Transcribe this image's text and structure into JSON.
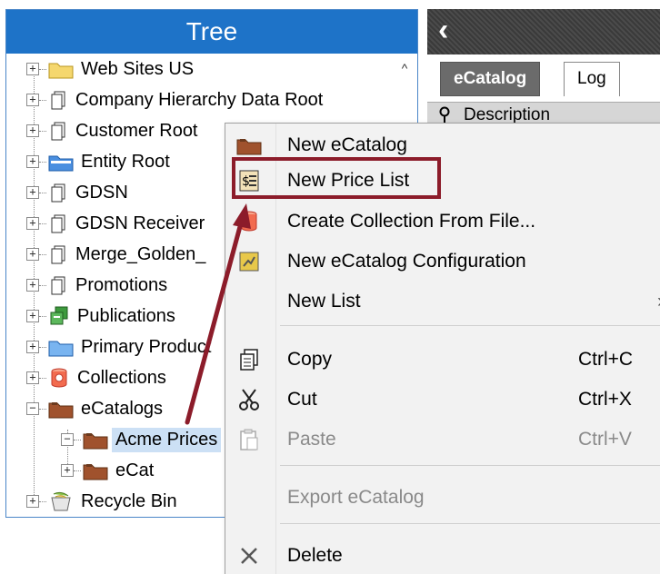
{
  "tree": {
    "title": "Tree",
    "items": [
      {
        "label": "Web Sites US",
        "icon": "yellow-folder-icon",
        "expander": "+"
      },
      {
        "label": "Company Hierarchy Data Root",
        "icon": "hierarchy-root-icon",
        "expander": "+"
      },
      {
        "label": "Customer Root",
        "icon": "hierarchy-root-icon",
        "expander": "+"
      },
      {
        "label": "Entity Root",
        "icon": "blue-folder-icon",
        "expander": "+"
      },
      {
        "label": "GDSN",
        "icon": "hierarchy-root-icon",
        "expander": "+"
      },
      {
        "label": "GDSN Receiver",
        "icon": "hierarchy-root-icon",
        "expander": "+"
      },
      {
        "label": "Merge_Golden_",
        "icon": "hierarchy-root-icon",
        "expander": "+"
      },
      {
        "label": "Promotions",
        "icon": "hierarchy-root-icon",
        "expander": "+"
      },
      {
        "label": "Publications",
        "icon": "publications-icon",
        "expander": "+"
      },
      {
        "label": "Primary Product",
        "icon": "blue-folder-icon",
        "expander": "+"
      },
      {
        "label": "Collections",
        "icon": "collections-icon",
        "expander": "+"
      },
      {
        "label": "eCatalogs",
        "icon": "ecatalog-folder-icon",
        "expander": "−"
      },
      {
        "label": "Acme Prices",
        "icon": "ecatalog-folder-icon",
        "expander": "−"
      },
      {
        "label": "eCat",
        "icon": "ecatalog-folder-icon",
        "expander": "+"
      },
      {
        "label": "Recycle Bin",
        "icon": "recycle-bin-icon",
        "expander": "+"
      }
    ]
  },
  "right_panel": {
    "back_glyph": "‹",
    "tabs": [
      {
        "label": "eCatalog",
        "active": true
      },
      {
        "label": "Log",
        "active": false
      }
    ],
    "property_label": "Description"
  },
  "context_menu": {
    "items": [
      {
        "label": "New eCatalog",
        "icon": "ecatalog-folder-icon",
        "shortcut": "",
        "disabled": false
      },
      {
        "label": "New Price List",
        "icon": "price-list-icon",
        "shortcut": "",
        "disabled": false
      },
      {
        "label": "Create Collection From File...",
        "icon": "collection-db-icon",
        "shortcut": "",
        "disabled": false
      },
      {
        "label": "New eCatalog Configuration",
        "icon": "configuration-icon",
        "shortcut": "",
        "disabled": false
      },
      {
        "label": "New List",
        "icon": "",
        "shortcut": "",
        "submenu_arrow": "›",
        "disabled": false
      },
      {
        "label": "Copy",
        "icon": "copy-icon",
        "shortcut": "Ctrl+C",
        "disabled": false
      },
      {
        "label": "Cut",
        "icon": "cut-icon",
        "shortcut": "Ctrl+X",
        "disabled": false
      },
      {
        "label": "Paste",
        "icon": "paste-icon",
        "shortcut": "Ctrl+V",
        "disabled": true
      },
      {
        "label": "Export eCatalog",
        "icon": "",
        "shortcut": "",
        "disabled": true
      },
      {
        "label": "Delete",
        "icon": "delete-icon",
        "shortcut": "",
        "disabled": false
      }
    ]
  },
  "colors": {
    "tree_header": "#1e73c8",
    "annotation": "#8c1c2a",
    "selection": "#cce0f5"
  }
}
